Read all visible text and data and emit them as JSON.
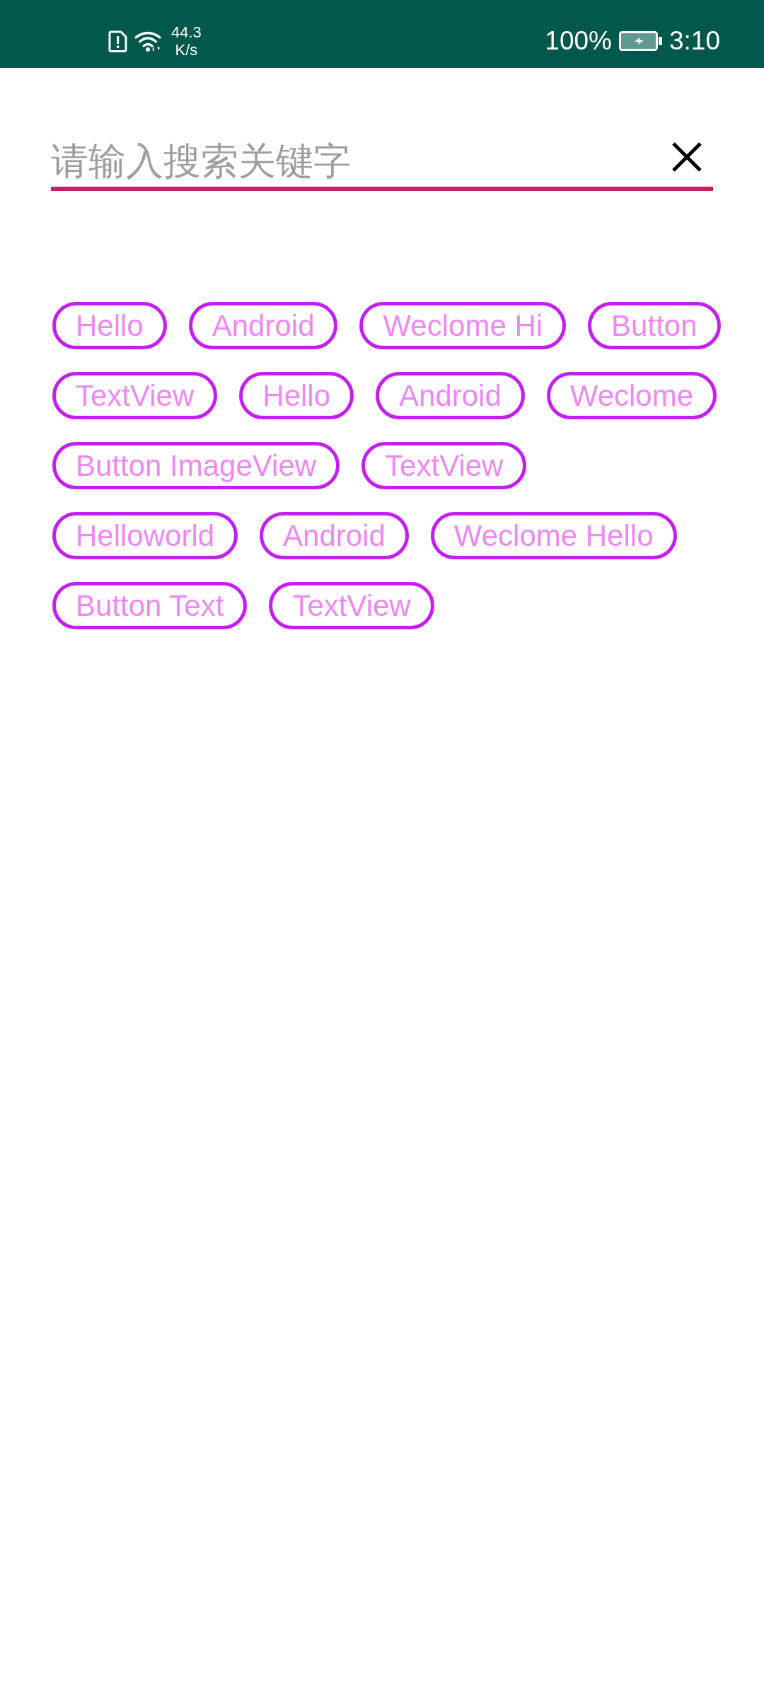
{
  "status_bar": {
    "network_speed": "44.3",
    "network_speed_unit": "K/s",
    "battery": "100%",
    "battery_charging": true,
    "time": "3:10"
  },
  "search": {
    "placeholder": "请输入搜索关键字"
  },
  "tag_rows": [
    [
      "Hello",
      "Android",
      "Weclome Hi",
      "Button"
    ],
    [
      "TextView",
      "Hello",
      "Android",
      "Weclome"
    ],
    [
      "Button ImageView",
      "TextView"
    ],
    [
      "Helloworld",
      "Android",
      "Weclome Hello"
    ],
    [
      "Button Text",
      "TextView"
    ]
  ]
}
